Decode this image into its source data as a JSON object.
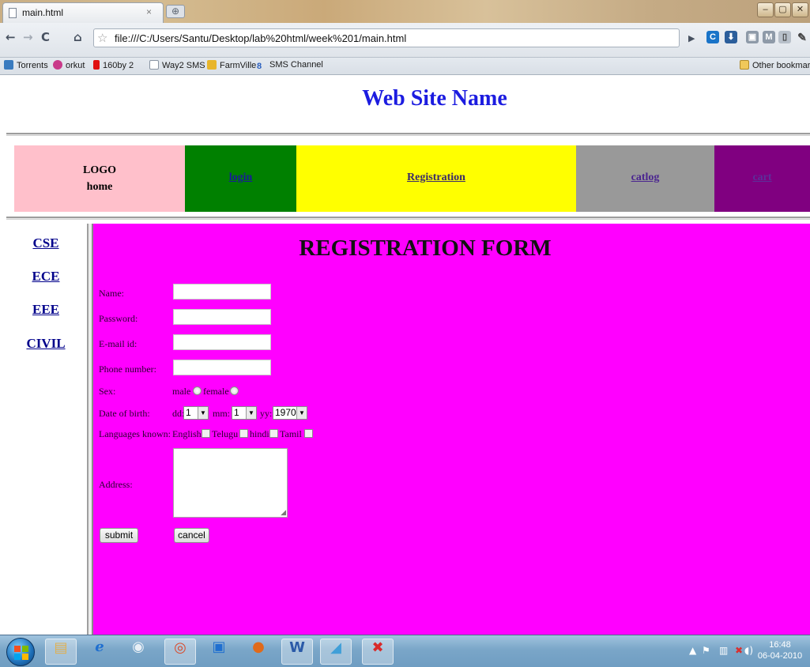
{
  "browser": {
    "tab_title": "main.html",
    "tab_close": "×",
    "new_tab": "⊕",
    "window_controls": [
      "–",
      "▢",
      "✕"
    ],
    "url": "file:///C:/Users/Santu/Desktop/lab%20html/week%201/main.html",
    "nav": {
      "back": "←",
      "forward": "→",
      "reload": "C",
      "home": "⌂"
    },
    "bookmarks": [
      "Torrents",
      "orkut",
      "160by 2",
      "Way2 SMS",
      "FarmVille",
      "SMS Channel"
    ],
    "other_bookmarks": "Other bookmarks"
  },
  "page": {
    "site_title": "Web Site Name",
    "nav": {
      "logo": "LOGO",
      "home": "home",
      "login": "login",
      "registration": "Registration",
      "catlog": "catlog",
      "cart": "cart"
    },
    "sidebar": [
      "CSE",
      "ECE",
      "EEE",
      "CIVIL"
    ],
    "form": {
      "title": "REGISTRATION FORM",
      "labels": {
        "name": "Name:",
        "password": "Password:",
        "email": "E-mail id:",
        "phone": "Phone number:",
        "sex": "Sex:",
        "dob": "Date of birth:",
        "languages": "Languages known:",
        "address": "Address:"
      },
      "sex_options": [
        "male",
        "female"
      ],
      "dob": {
        "dd_label": "dd:",
        "dd_value": "1",
        "mm_label": "mm:",
        "mm_value": "1",
        "yy_label": "yy:",
        "yy_value": "1970"
      },
      "languages": [
        "English",
        "Telugu",
        "hindi",
        "Tamil"
      ],
      "submit": "submit",
      "cancel": "cancel"
    }
  },
  "taskbar": {
    "time": "16:48",
    "date": "06-04-2010"
  },
  "colors": {
    "site_title": "#1c1ce0",
    "logo_cell": "#ffc0cb",
    "login_cell": "#008000",
    "registration_cell": "#ffff00",
    "catlog_cell": "#999999",
    "cart_cell": "#800080",
    "form_background": "#ff00ff"
  }
}
